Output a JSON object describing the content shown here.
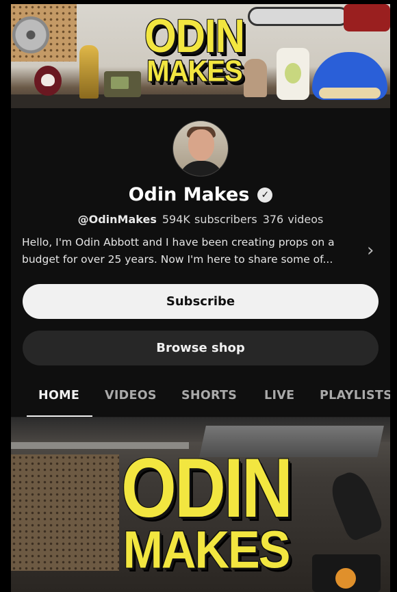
{
  "banner": {
    "logo_line1": "ODIN",
    "logo_line2": "MAKES"
  },
  "channel": {
    "name": "Odin Makes",
    "handle": "@OdinMakes",
    "subscribers": "594K subscribers",
    "videos": "376 videos",
    "description": "Hello, I'm Odin Abbott and I have been creating props on a budget for over 25 years. Now I'm here to share some of..."
  },
  "buttons": {
    "subscribe": "Subscribe",
    "browse_shop": "Browse shop"
  },
  "tabs": [
    {
      "label": "HOME",
      "active": true
    },
    {
      "label": "VIDEOS",
      "active": false
    },
    {
      "label": "SHORTS",
      "active": false
    },
    {
      "label": "LIVE",
      "active": false
    },
    {
      "label": "PLAYLISTS",
      "active": false
    }
  ],
  "featured": {
    "logo_line1": "ODIN",
    "logo_line2": "MAKES"
  },
  "icons": {
    "verified": "verified-check-icon",
    "expand": "chevron-right-icon"
  },
  "colors": {
    "background": "#0f0f0f",
    "logo_yellow": "#f2e640",
    "subscribe_bg": "#f1f1f1",
    "secondary_button_bg": "#272727"
  }
}
